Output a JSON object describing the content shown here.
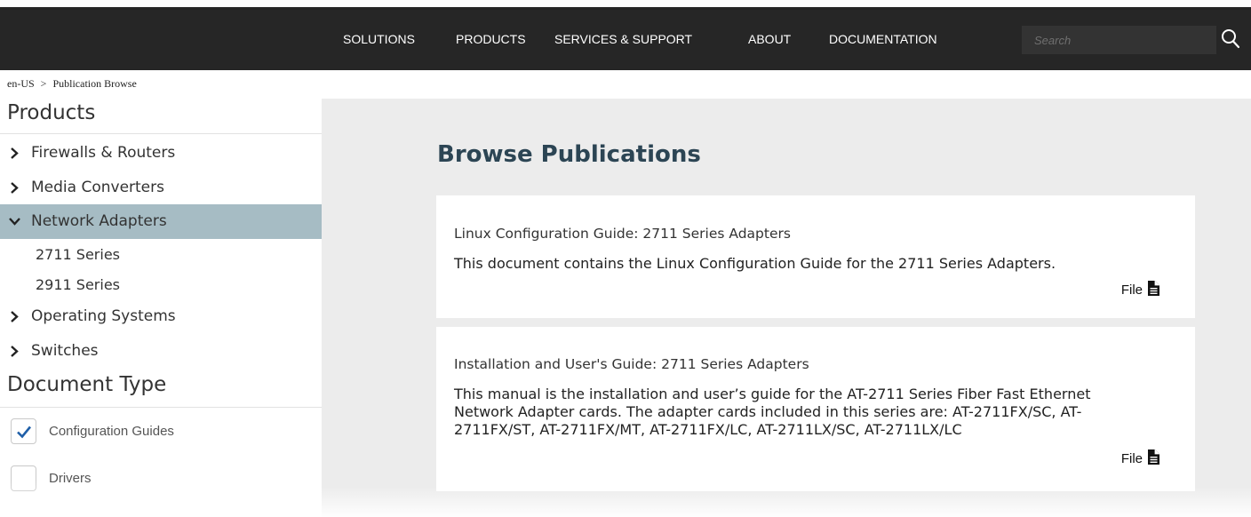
{
  "nav": {
    "items": [
      "SOLUTIONS",
      "PRODUCTS",
      "SERVICES & SUPPORT",
      "ABOUT",
      "DOCUMENTATION"
    ],
    "search_placeholder": "Search",
    "search_icon": "search-icon"
  },
  "breadcrumb": {
    "items": [
      "en-US",
      "Publication Browse"
    ],
    "separator": ">"
  },
  "sidebar": {
    "products_heading": "Products",
    "products": [
      {
        "label": "Firewalls & Routers",
        "expanded": false
      },
      {
        "label": "Media Converters",
        "expanded": false
      },
      {
        "label": "Network Adapters",
        "expanded": true,
        "children": [
          "2711 Series",
          "2911 Series"
        ]
      },
      {
        "label": "Operating Systems",
        "expanded": false
      },
      {
        "label": "Switches",
        "expanded": false
      }
    ],
    "doc_type_heading": "Document Type",
    "doc_types": [
      {
        "label": "Configuration Guides",
        "checked": true
      },
      {
        "label": "Drivers",
        "checked": false
      }
    ]
  },
  "main": {
    "title": "Browse Publications",
    "publications": [
      {
        "title": "Linux Configuration Guide: 2711 Series Adapters",
        "description": "This document contains the Linux Configuration Guide for the 2711 Series Adapters.",
        "file_label": "File",
        "file_icon": "document-icon"
      },
      {
        "title": "Installation and User's Guide: 2711 Series Adapters",
        "description": "This manual is the installation and user’s guide for the AT-2711 Series Fiber Fast Ethernet Network Adapter cards. The adapter cards included in this series are: AT-2711FX/SC, AT-2711FX/ST, AT-2711FX/MT, AT-2711FX/LC, AT-2711LX/SC, AT-2711LX/LC",
        "file_label": "File",
        "file_icon": "document-icon"
      }
    ]
  },
  "colors": {
    "topbar": "#262626",
    "active_item": "#a6bcc4",
    "title": "#2c4554",
    "main_bg": "#ececec",
    "check_accent": "#1f5fa8"
  }
}
